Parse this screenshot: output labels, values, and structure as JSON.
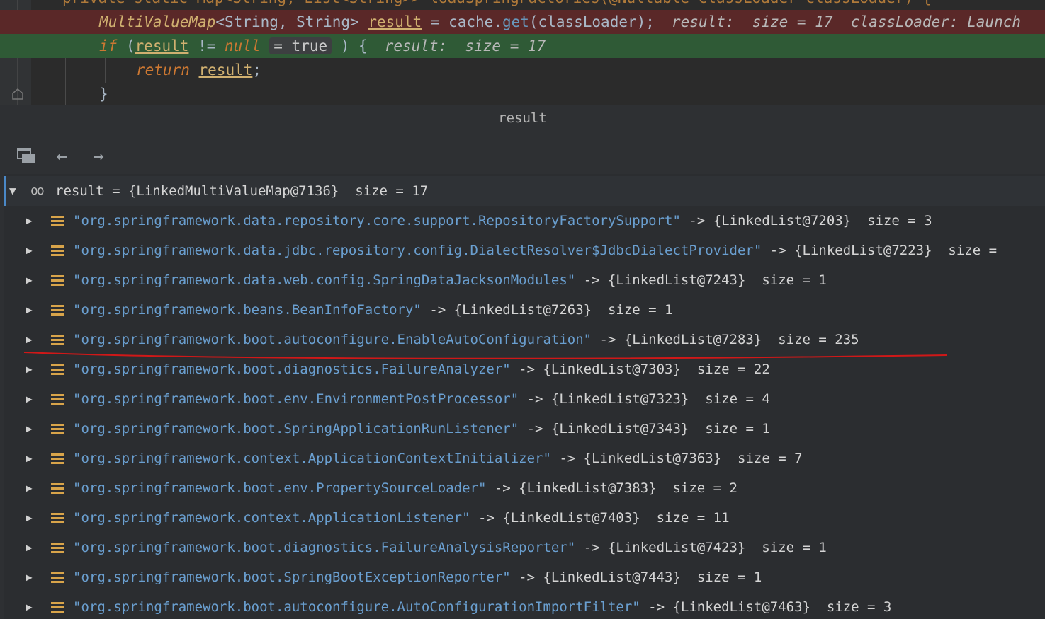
{
  "editor": {
    "line0": "private static Map<String, List<String>> loadSpringFactories(@Nullable ClassLoader classLoader) {",
    "line1_code_type": "MultiValueMap",
    "line1_code_generic": "<String, String> ",
    "line1_var": "result",
    "line1_rest": " = cache.",
    "line1_method": "get",
    "line1_tail": "(classLoader);",
    "line1_hint": "result:  size = 17  classLoader: Launch",
    "line2_if": "if",
    "line2_open": " (",
    "line2_var": "result",
    "line2_op": " != ",
    "line2_null": "null",
    "line2_bool": "= true",
    "line2_close": " ) {",
    "line2_hint": "result:  size = 17",
    "line3_return": "return",
    "line3_var": "result",
    "line3_semi": ";",
    "line4": "}"
  },
  "panel": {
    "title": "result"
  },
  "tree": {
    "root": "result = {LinkedMultiValueMap@7136}  size = 17",
    "items": [
      {
        "key": "\"org.springframework.data.repository.core.support.RepositoryFactorySupport\"",
        "value": " -> {LinkedList@7203}  size = 3"
      },
      {
        "key": "\"org.springframework.data.jdbc.repository.config.DialectResolver$JdbcDialectProvider\"",
        "value": " -> {LinkedList@7223}  size ="
      },
      {
        "key": "\"org.springframework.data.web.config.SpringDataJacksonModules\"",
        "value": " -> {LinkedList@7243}  size = 1"
      },
      {
        "key": "\"org.springframework.beans.BeanInfoFactory\"",
        "value": " -> {LinkedList@7263}  size = 1"
      },
      {
        "key": "\"org.springframework.boot.autoconfigure.EnableAutoConfiguration\"",
        "value": " -> {LinkedList@7283}  size = 235"
      },
      {
        "key": "\"org.springframework.boot.diagnostics.FailureAnalyzer\"",
        "value": " -> {LinkedList@7303}  size = 22"
      },
      {
        "key": "\"org.springframework.boot.env.EnvironmentPostProcessor\"",
        "value": " -> {LinkedList@7323}  size = 4"
      },
      {
        "key": "\"org.springframework.boot.SpringApplicationRunListener\"",
        "value": " -> {LinkedList@7343}  size = 1"
      },
      {
        "key": "\"org.springframework.context.ApplicationContextInitializer\"",
        "value": " -> {LinkedList@7363}  size = 7"
      },
      {
        "key": "\"org.springframework.boot.env.PropertySourceLoader\"",
        "value": " -> {LinkedList@7383}  size = 2"
      },
      {
        "key": "\"org.springframework.context.ApplicationListener\"",
        "value": " -> {LinkedList@7403}  size = 11"
      },
      {
        "key": "\"org.springframework.boot.diagnostics.FailureAnalysisReporter\"",
        "value": " -> {LinkedList@7423}  size = 1"
      },
      {
        "key": "\"org.springframework.boot.SpringBootExceptionReporter\"",
        "value": " -> {LinkedList@7443}  size = 1"
      },
      {
        "key": "\"org.springframework.boot.autoconfigure.AutoConfigurationImportFilter\"",
        "value": " -> {LinkedList@7463}  size = 3"
      }
    ]
  },
  "colors": {
    "breakpoint_line": "#5a2828",
    "execution_line": "#2f5a36",
    "annotation_red": "#d01818",
    "field_icon": "#d8a44a"
  },
  "icons": {
    "restore": "restore-layout-icon",
    "back": "back-arrow-icon",
    "forward": "forward-arrow-icon",
    "watch": "glasses-icon",
    "field": "field-icon"
  }
}
